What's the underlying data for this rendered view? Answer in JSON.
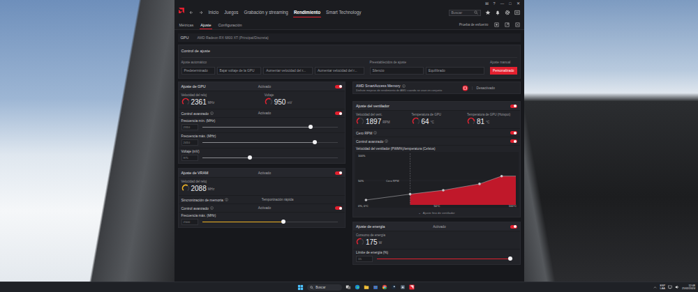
{
  "window": {
    "controls": [
      "⊞",
      "?",
      "—",
      "□",
      "✕"
    ]
  },
  "nav": {
    "tabs": [
      {
        "label": "Inicio",
        "selected": false
      },
      {
        "label": "Juegos",
        "selected": false
      },
      {
        "label": "Grabación y streaming",
        "selected": false
      },
      {
        "label": "Rendimiento",
        "selected": true
      },
      {
        "label": "Smart Technology",
        "selected": false
      }
    ],
    "search_placeholder": "Buscar"
  },
  "subtabs": [
    {
      "label": "Métricas",
      "selected": false
    },
    {
      "label": "Ajuste",
      "selected": true
    },
    {
      "label": "Configuración",
      "selected": false
    }
  ],
  "stress_test": "Prueba de esfuerzo",
  "device": {
    "label": "GPU",
    "name": "AMD Radeon RX 6800 XT (Principal/Discreta)"
  },
  "tuning_control": {
    "title": "Control de ajuste",
    "groups": [
      {
        "label": "Ajuste automático",
        "options": [
          {
            "label": "Predeterminado",
            "selected": false
          },
          {
            "label": "Bajar voltaje de la GPU",
            "selected": false
          },
          {
            "label": "Aumentar velocidad del r...",
            "selected": false
          },
          {
            "label": "Aumentar velocidad del r...",
            "selected": false
          }
        ]
      },
      {
        "label": "Preestablecidos de ajuste",
        "options": [
          {
            "label": "Silencio",
            "selected": false
          },
          {
            "label": "Equilibrado",
            "selected": false
          }
        ]
      },
      {
        "label": "Ajuste manual",
        "options": [
          {
            "label": "Personalizado",
            "selected": true
          }
        ]
      }
    ]
  },
  "left_panels": [
    {
      "kind": "section",
      "title": "Ajuste de GPU",
      "state": "Activado",
      "on": true,
      "rows": [
        {
          "kind": "gauges",
          "items": [
            {
              "label": "Velocidad del reloj",
              "value": "2361",
              "unit": "MHz",
              "level": 0.72,
              "color": "#e3202f"
            },
            {
              "label": "Voltaje",
              "value": "950",
              "unit": "mV",
              "level": 0.6,
              "color": "#e3202f"
            }
          ]
        },
        {
          "kind": "toggle",
          "label": "Control avanzado",
          "info": true,
          "state": "Activado",
          "on": true
        },
        {
          "kind": "slider",
          "label": "Frecuencia mín. (MHz)",
          "info": false,
          "value": "2310",
          "level": 0.8,
          "color": "#8a8b90"
        },
        {
          "kind": "slider",
          "label": "Frecuencia máx. (MHz)",
          "info": false,
          "value": "2410",
          "level": 0.83,
          "color": "#8a8b90"
        },
        {
          "kind": "slider",
          "label": "Voltaje (mV)",
          "info": false,
          "value": "975",
          "level": 0.35,
          "color": "#8a8b90"
        }
      ]
    },
    {
      "kind": "section",
      "title": "Ajuste de VRAM",
      "state": "Activado",
      "on": true,
      "rows": [
        {
          "kind": "gauges",
          "items": [
            {
              "label": "Velocidad del reloj",
              "value": "2088",
              "unit": "MHz",
              "level": 0.62,
              "color": "#f0b323"
            }
          ]
        },
        {
          "kind": "text",
          "label": "Sincronización de memoria",
          "info": true,
          "state": "Temporización rápida"
        },
        {
          "kind": "toggle",
          "label": "Control avanzado",
          "info": true,
          "state": "Activado",
          "on": true
        },
        {
          "kind": "slider",
          "label": "Frecuencia máx. (MHz)",
          "info": false,
          "value": "2100",
          "level": 0.6,
          "color": "#f0b323"
        }
      ]
    }
  ],
  "right_panels": [
    {
      "kind": "feature",
      "title": "AMD SmartAccess Memory",
      "info": true,
      "description": "Disfrute mejoras de rendimiento de AMD cuando se usan en conjunto",
      "state": "Desactivado"
    },
    {
      "kind": "section",
      "title": "Ajuste del ventilador",
      "state": "",
      "on": true,
      "rows": [
        {
          "kind": "gauges",
          "items": [
            {
              "label": "Velocidad del vent.",
              "value": "1897",
              "unit": "RPM",
              "level": 0.45,
              "color": "#e3202f"
            },
            {
              "label": "Temperatura de GPU",
              "value": "64",
              "unit": "°C",
              "level": 0.64,
              "color": "#e3202f"
            },
            {
              "label": "Temperatura de GPU (Hotspot)",
              "value": "81",
              "unit": "°C",
              "level": 0.81,
              "color": "#e3202f"
            }
          ]
        },
        {
          "kind": "toggle",
          "label": "Cero RPM",
          "info": true,
          "state": "",
          "on": true
        },
        {
          "kind": "toggle",
          "label": "Control avanzado",
          "info": true,
          "state": "",
          "on": true
        },
        {
          "kind": "chart",
          "title": "Velocidad del ventilador (PWM%)/temperatura (Celsius)",
          "y_ticks": [
            "100%",
            "50%"
          ],
          "origin": "0%, 0°C",
          "x_ticks": [
            "50°C",
            "100°C"
          ],
          "zone_label": "Cero RPM",
          "zero_rpm_index": 1,
          "temps": [
            5,
            33,
            54,
            77,
            91
          ],
          "pwm": [
            10,
            22,
            30,
            43,
            59
          ],
          "footer_icon": "⌄",
          "footer": "Ajuste fino de ventilador"
        }
      ]
    },
    {
      "kind": "section",
      "title": "Ajuste de energía",
      "state": "Activado",
      "on": true,
      "rows": [
        {
          "kind": "gauges",
          "items": [
            {
              "label": "Consumo de energía",
              "value": "175",
              "unit": "W",
              "level": 0.55,
              "color": "#e3202f"
            }
          ]
        },
        {
          "kind": "slider",
          "label": "Límite de energía (%)",
          "info": false,
          "value": "15",
          "level": 0.98,
          "color": "#e3202f"
        }
      ]
    }
  ],
  "taskbar": {
    "search_placeholder": "Buscar",
    "language": [
      "ESP",
      "LAA"
    ],
    "time": "12:08",
    "date": "21/02/2024"
  }
}
